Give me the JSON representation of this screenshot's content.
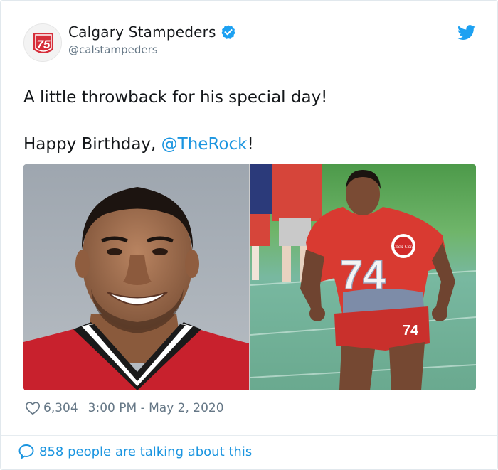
{
  "author": {
    "display_name": "Calgary Stampeders",
    "handle": "@calstampeders",
    "avatar_text": "75",
    "verified": true
  },
  "tweet": {
    "line1": "A little throwback for his special day!",
    "line2_prefix": "Happy Birthday, ",
    "line2_mention": "@TheRock",
    "line2_suffix": "!"
  },
  "media": {
    "right_jersey_number": "74",
    "right_shorts_number": "74",
    "right_logo_text": "Coca-Cola"
  },
  "meta": {
    "like_count": "6,304",
    "timestamp": "3:00 PM - May 2, 2020"
  },
  "footer": {
    "talking_text": "858 people are talking about this"
  },
  "colors": {
    "link": "#1b95e0",
    "secondary_text": "#657786",
    "twitter_blue": "#1da1f2"
  }
}
